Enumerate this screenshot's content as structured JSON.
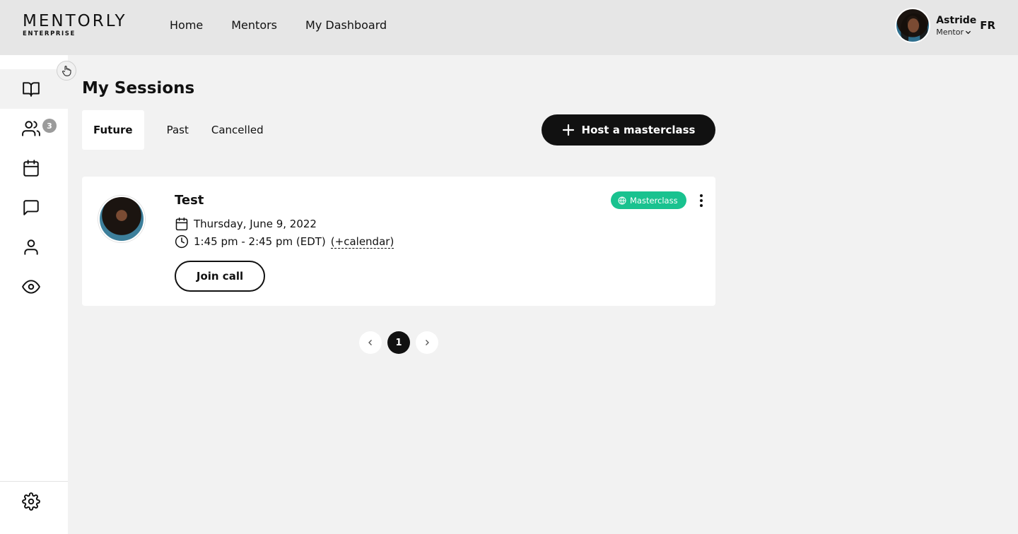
{
  "header": {
    "logo": {
      "main": "MENTORLY",
      "sub": "ENTERPRISE"
    },
    "nav": [
      "Home",
      "Mentors",
      "My Dashboard"
    ],
    "user": {
      "name": "Astride",
      "role": "Mentor"
    },
    "language": "FR"
  },
  "sidebar": {
    "items": [
      {
        "icon": "book-open-icon",
        "active": true
      },
      {
        "icon": "users-icon",
        "badge": "3"
      },
      {
        "icon": "calendar-icon"
      },
      {
        "icon": "message-icon"
      },
      {
        "icon": "user-icon"
      },
      {
        "icon": "eye-icon"
      }
    ],
    "bottom": [
      {
        "icon": "gear-icon"
      }
    ]
  },
  "main": {
    "title": "My Sessions",
    "tabs": [
      {
        "label": "Future",
        "active": true
      },
      {
        "label": "Past"
      },
      {
        "label": "Cancelled"
      }
    ],
    "host_button": "Host a masterclass",
    "sessions": [
      {
        "title": "Test",
        "date": "Thursday, June 9, 2022",
        "time": "1:45 pm - 2:45 pm (EDT)",
        "calendar_link": "(+calendar)",
        "join_label": "Join call",
        "tag": "Masterclass"
      }
    ],
    "pagination": {
      "current": "1"
    }
  },
  "colors": {
    "header_bg": "#e6e6e6",
    "page_bg": "#f2f2f2",
    "primary": "#111111",
    "tag_green": "#19c28f",
    "badge_gray": "#9b9b9b"
  }
}
